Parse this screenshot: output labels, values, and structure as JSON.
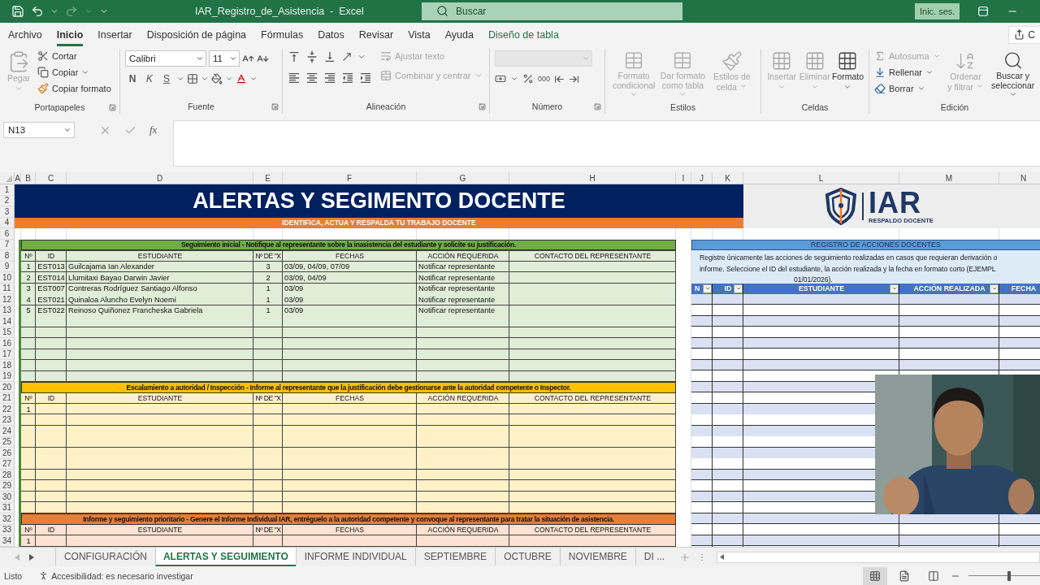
{
  "window": {
    "title": "IAR_Registro_de_Asistencia  -  Excel",
    "search_placeholder": "Buscar",
    "sign_in": "Inic. ses."
  },
  "menu": [
    {
      "label": "Archivo",
      "selected": false,
      "kind": "tab"
    },
    {
      "label": "Inicio",
      "selected": true,
      "kind": "tab"
    },
    {
      "label": "Insertar",
      "selected": false,
      "kind": "tab"
    },
    {
      "label": "Disposición de página",
      "selected": false,
      "kind": "tab"
    },
    {
      "label": "Fórmulas",
      "selected": false,
      "kind": "tab"
    },
    {
      "label": "Datos",
      "selected": false,
      "kind": "tab"
    },
    {
      "label": "Revisar",
      "selected": false,
      "kind": "tab"
    },
    {
      "label": "Vista",
      "selected": false,
      "kind": "tab"
    },
    {
      "label": "Ayuda",
      "selected": false,
      "kind": "tab"
    },
    {
      "label": "Diseño de tabla",
      "selected": false,
      "kind": "contextual"
    }
  ],
  "share_button": "C",
  "clipboard": {
    "label": "Portapapeles",
    "paste": {
      "label": "Pegar",
      "disabled": true
    },
    "cut": "Cortar",
    "copy": "Copiar",
    "format_painter": "Copiar formato"
  },
  "font": {
    "label": "Fuente",
    "name": "Calibri",
    "size": "11",
    "bold": "N",
    "italic": "K",
    "underline": "S"
  },
  "alignment": {
    "label": "Alineación",
    "wrap": {
      "label": "Ajustar texto",
      "disabled": true
    },
    "merge": {
      "label": "Combinar y centrar",
      "disabled": true
    }
  },
  "number": {
    "label": "Número",
    "format_field": {
      "disabled": true
    },
    "thousands": "000"
  },
  "styles": {
    "label": "Estilos",
    "items": [
      {
        "label": "Formato condicional",
        "disabled": true
      },
      {
        "label": "Dar formato como tabla",
        "disabled": true
      },
      {
        "label": "Estilos de celda",
        "disabled": true
      }
    ]
  },
  "cells": {
    "label": "Celdas",
    "items": [
      {
        "label": "Insertar",
        "disabled": true
      },
      {
        "label": "Eliminar",
        "disabled": true
      },
      {
        "label": "Formato",
        "disabled": false
      }
    ]
  },
  "editing": {
    "label": "Edición",
    "autosum": {
      "label": "Autosuma",
      "disabled": true
    },
    "fill": {
      "label": "Rellenar",
      "disabled": false
    },
    "clear": {
      "label": "Borrar",
      "disabled": false
    },
    "sort": {
      "label": "Ordenar y filtrar",
      "disabled": true
    },
    "find": {
      "label": "Buscar y seleccionar",
      "disabled": false
    }
  },
  "formula_bar": {
    "name_box": "N13",
    "fx": "fx"
  },
  "columns": [
    "A",
    "B",
    "C",
    "D",
    "E",
    "F",
    "G",
    "H",
    "I",
    "J",
    "K",
    "L",
    "M",
    "N"
  ],
  "rows": [
    "1",
    "2",
    "3",
    "4",
    "6",
    "7",
    "8",
    "9",
    "10",
    "11",
    "12",
    "13",
    "14",
    "15",
    "16",
    "17",
    "18",
    "19",
    "20",
    "21",
    "22",
    "23",
    "24",
    "25",
    "26",
    "27",
    "28",
    "29",
    "30",
    "31",
    "32",
    "33",
    "34"
  ],
  "banner": {
    "title": "ALERTAS Y SEGIMENTO DOCENTE",
    "subtitle": "IDENTIFICA, ACTUA Y RESPALDA TU TRABAJO DOCENTE",
    "logo_name": "IAR",
    "logo_tagline": "RESPALDO DOCENTE"
  },
  "sections": [
    {
      "heading": "Seguimiento inicial - Notifique al representante sobre la inasistencia del estudiante y solicite su justificación.",
      "color": "#70ad47",
      "columns": [
        "Nº",
        "ID",
        "ESTUDIANTE",
        "Nº DE \"X",
        "FECHAS",
        "ACCIÓN REQUERIDA",
        "CONTACTO DEL REPRESENTANTE"
      ],
      "rows": [
        [
          "1",
          "EST013",
          "Guilcajama Ian Alexander",
          "3",
          "03/09, 04/09, 07/09",
          "Notificar representante"
        ],
        [
          "2",
          "EST014",
          "Llumitaxi Bayao Darwin Javier",
          "2",
          "03/09, 04/09",
          "Notificar representante"
        ],
        [
          "3",
          "EST007",
          "Contreras Rodríguez Santiago Alfonso",
          "1",
          "03/09",
          "Notificar representante"
        ],
        [
          "4",
          "EST021",
          "Quinaloa Aluncho Evelyn Noemi",
          "1",
          "03/09",
          "Notificar representante"
        ],
        [
          "5",
          "EST022",
          "Reinoso Quiñonez Francheska Gabriela",
          "1",
          "03/09",
          "Notificar representante"
        ]
      ]
    },
    {
      "heading": "Escalamiento a autoridad / Inspección - Informe al representante que la justificación debe gestionarse ante la autoridad competente o Inspector.",
      "color": "#ffc000",
      "columns": [
        "Nº",
        "ID",
        "ESTUDIANTE",
        "Nº DE \"X",
        "FECHAS",
        "ACCIÓN REQUERIDA",
        "CONTACTO DEL REPRESENTANTE"
      ],
      "rows": [
        [
          "1"
        ]
      ]
    },
    {
      "heading": "Informe y seguimiento prioritario - Genere el Informe Individual IAR, entréguelo a la autoridad competente y convoque al representante para tratar la situación de asistencia.",
      "color": "#ed7d31",
      "columns": [
        "Nº",
        "ID",
        "ESTUDIANTE",
        "Nº DE \"X",
        "FECHAS",
        "ACCIÓN REQUERIDA",
        "CONTACTO DEL REPRESENTANTE"
      ],
      "rows": [
        [
          "1"
        ]
      ]
    }
  ],
  "register": {
    "title": "REGISTRO DE ACCIONES DOCENTES",
    "instructions": [
      "Registre únicamente las acciones de seguimiento realizadas en casos que requieran derivación o",
      "informe. Seleccione el ID del estudiante, la acción realizada y la fecha  en formato corto (EJEMPL",
      "01/01/2026)."
    ],
    "columns": [
      "N",
      "ID",
      "ESTUDIANTE",
      "ACCIÓN REALIZADA",
      "FECHA"
    ]
  },
  "sheet_tabs": [
    {
      "label": "CONFIGURACIÓN",
      "selected": false
    },
    {
      "label": "ALERTAS Y SEGUIMIENTO",
      "selected": true
    },
    {
      "label": "INFORME INDIVIDUAL",
      "selected": false
    },
    {
      "label": "SEPTIEMBRE",
      "selected": false
    },
    {
      "label": "OCTUBRE",
      "selected": false
    },
    {
      "label": "NOVIEMBRE",
      "selected": false
    },
    {
      "label": "DI ...",
      "selected": false
    }
  ],
  "status": {
    "ready": "Listo",
    "accessibility": "Accesibilidad: es necesario investigar",
    "views": [
      {
        "selected": true
      },
      {
        "selected": false
      },
      {
        "selected": false
      }
    ],
    "zoom": {
      "level": 0.5
    }
  }
}
